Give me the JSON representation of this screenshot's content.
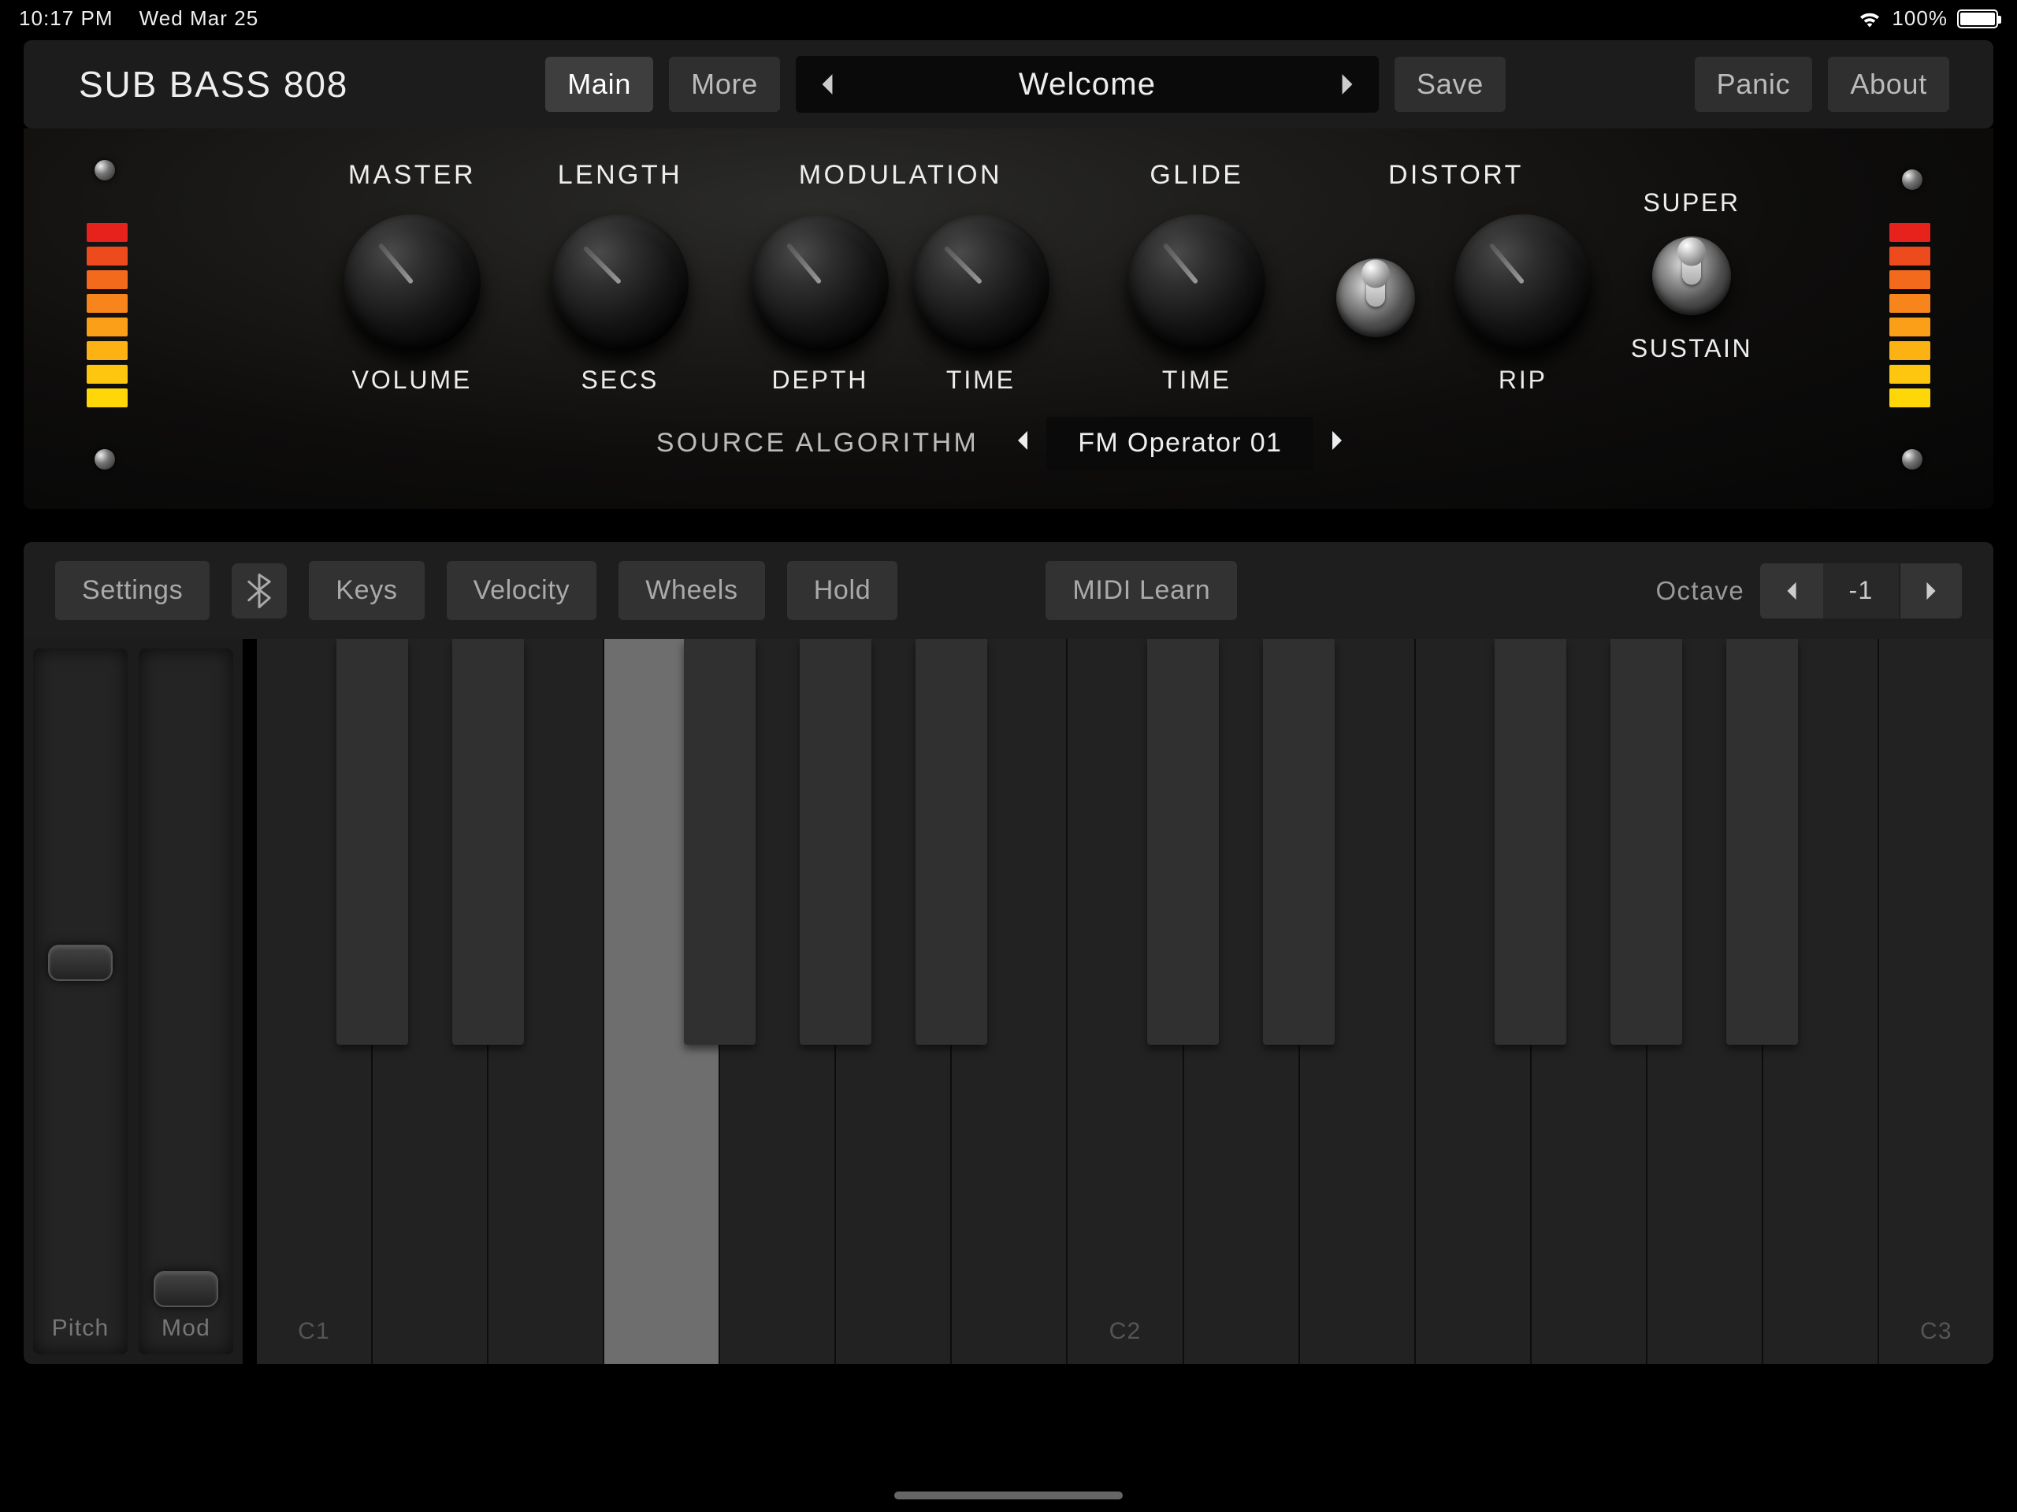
{
  "status": {
    "time": "10:17 PM",
    "date": "Wed Mar 25",
    "battery": "100%"
  },
  "header": {
    "logo_heavy": "SUB BASS",
    "logo_light": "808",
    "main": "Main",
    "more": "More",
    "preset": "Welcome",
    "save": "Save",
    "panic": "Panic",
    "about": "About"
  },
  "panel": {
    "knob_groups": {
      "master": {
        "title": "MASTER",
        "sub": "VOLUME",
        "angle": 140
      },
      "length": {
        "title": "LENGTH",
        "sub": "SECS",
        "angle": 135
      },
      "mod_depth": {
        "title": "MODULATION",
        "sub": "DEPTH",
        "angle": 140
      },
      "mod_time": {
        "sub": "TIME",
        "angle": 135
      },
      "glide": {
        "title": "GLIDE",
        "sub": "TIME",
        "angle": 140
      },
      "distort": {
        "title": "DISTORT",
        "sub": "RIP",
        "angle": 140
      }
    },
    "toggles": {
      "distort_enable": {
        "state": "up"
      },
      "super_sustain": {
        "top": "SUPER",
        "bottom": "SUSTAIN",
        "state": "up"
      }
    },
    "meter_colors_top_to_bottom": [
      "#e7221c",
      "#ed4a1e",
      "#f46a1d",
      "#f8851b",
      "#fb9e18",
      "#fdb214",
      "#fec60f",
      "#ffd607"
    ],
    "source": {
      "label": "SOURCE ALGORITHM",
      "value": "FM Operator 01"
    }
  },
  "kb_toolbar": {
    "settings": "Settings",
    "keys": "Keys",
    "velocity": "Velocity",
    "wheels": "Wheels",
    "hold": "Hold",
    "midi_learn": "MIDI Learn",
    "octave_label": "Octave",
    "octave_value": "-1"
  },
  "keyboard": {
    "wheel_labels": {
      "pitch": "Pitch",
      "mod": "Mod"
    },
    "white_key_count": 15,
    "pressed_white_index": 3,
    "labels": {
      "0": "C1",
      "7": "C2",
      "14": "C3"
    },
    "black_key_pattern_per_octave": [
      0,
      1,
      3,
      4,
      5
    ],
    "black_key_width_frac": 0.62
  }
}
